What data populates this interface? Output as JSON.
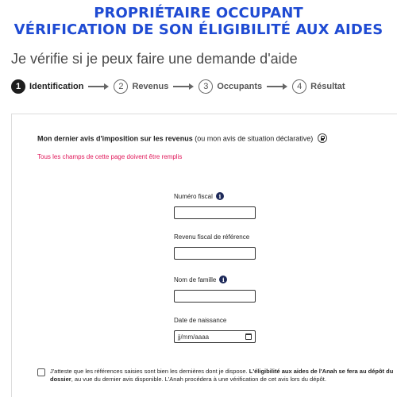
{
  "banner": {
    "line1": "PROPRIÉTAIRE OCCUPANT",
    "line2": "VÉRIFICATION DE SON ÉLIGIBILITÉ AUX AIDES"
  },
  "subtitle": "Je vérifie si je peux faire une demande d'aide",
  "steps": [
    {
      "number": "1",
      "label": "Identification",
      "active": true
    },
    {
      "number": "2",
      "label": "Revenus",
      "active": false
    },
    {
      "number": "3",
      "label": "Occupants",
      "active": false
    },
    {
      "number": "4",
      "label": "Résultat",
      "active": false
    }
  ],
  "form": {
    "title_bold": "Mon dernier avis d'imposition sur les revenus",
    "title_normal": " (ou mon avis de situation déclarative)",
    "required_note": "Tous les champs de cette page doivent être remplis",
    "fields": {
      "numero_fiscal": {
        "label": "Numéro fiscal",
        "value": ""
      },
      "revenu_fiscal": {
        "label": "Revenu fiscal de référence",
        "value": ""
      },
      "nom_famille": {
        "label": "Nom de famille",
        "value": ""
      },
      "date_naissance": {
        "label": "Date de naissance",
        "placeholder": "jj/mm/aaaa"
      }
    },
    "attest": {
      "text1": "J'atteste que les références saisies sont bien les dernières dont je dispose. ",
      "bold1": "L'éligibilité aux aides de l'Anah se fera au dépôt du dossier",
      "text2": ", au vue du dernier avis disponible. L'Anah procédera à une vérification de cet avis lors du dépôt.",
      "checked": false
    }
  },
  "icons": {
    "info": "info-icon",
    "lock": "lock-icon",
    "calendar": "calendar-icon",
    "step_arrow": "arrow-right-icon"
  },
  "colors": {
    "banner": "#1f4bd3",
    "required": "#e0185a",
    "info_icon": "#1e2a5a"
  }
}
